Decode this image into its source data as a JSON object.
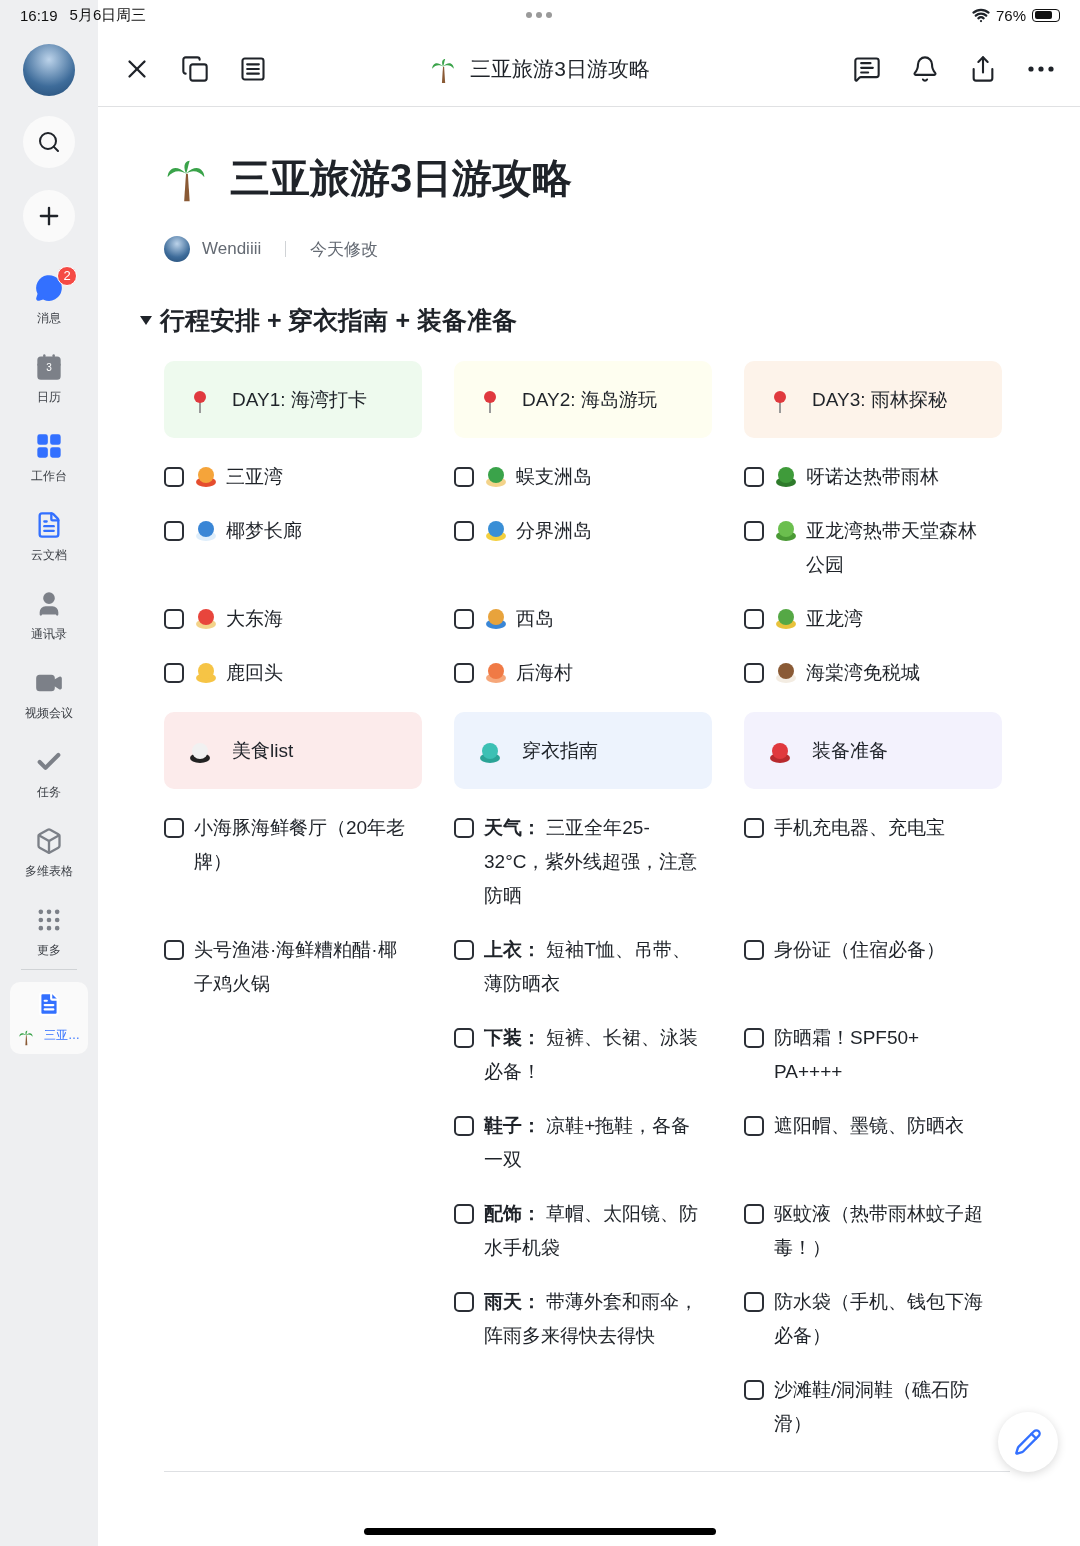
{
  "status_bar": {
    "time": "16:19",
    "date": "5月6日周三",
    "battery": "76%"
  },
  "sidebar": {
    "items": [
      {
        "label": "消息",
        "badge": "2",
        "selected": false
      },
      {
        "label": "日历",
        "calendar_day": "3",
        "selected": false
      },
      {
        "label": "工作台",
        "selected": false
      },
      {
        "label": "云文档",
        "selected": false
      },
      {
        "label": "通讯录",
        "selected": false
      },
      {
        "label": "视频会议",
        "selected": false
      },
      {
        "label": "任务",
        "selected": false
      },
      {
        "label": "多维表格",
        "selected": false
      },
      {
        "label": "更多",
        "selected": false
      }
    ],
    "open_doc": {
      "label": "三亚…",
      "selected": true
    }
  },
  "toolbar": {
    "title": "三亚旅游3日游攻略"
  },
  "document": {
    "title": "三亚旅游3日游攻略",
    "author": "Wendiiii",
    "modified": "今天修改",
    "section": {
      "title": "行程安排 + 穿衣指南 + 装备准备",
      "expanded": true,
      "groups": [
        {
          "columns": [
            {
              "header": "DAY1: 海湾打卡",
              "color": "#eefaee",
              "items": [
                {
                  "text": "三亚湾",
                  "checked": false
                },
                {
                  "text": "椰梦长廊",
                  "checked": false
                },
                {
                  "text": "大东海",
                  "checked": false
                },
                {
                  "text": "鹿回头",
                  "checked": false
                }
              ]
            },
            {
              "header": "DAY2: 海岛游玩",
              "color": "#fefef0",
              "items": [
                {
                  "text": "蜈支洲岛",
                  "checked": false
                },
                {
                  "text": "分界洲岛",
                  "checked": false
                },
                {
                  "text": "西岛",
                  "checked": false
                },
                {
                  "text": "后海村",
                  "checked": false
                }
              ]
            },
            {
              "header": "DAY3: 雨林探秘",
              "color": "#fdf3ea",
              "items": [
                {
                  "text": "呀诺达热带雨林",
                  "checked": false
                },
                {
                  "text": "亚龙湾热带天堂森林公园",
                  "checked": false
                },
                {
                  "text": "亚龙湾",
                  "checked": false
                },
                {
                  "text": "海棠湾免税城",
                  "checked": false
                }
              ]
            }
          ]
        },
        {
          "columns": [
            {
              "header": "美食list",
              "color": "#fcebeb",
              "items": [
                {
                  "text": "小海豚海鲜餐厅（20年老牌）",
                  "checked": false
                },
                {
                  "text": "头号渔港·海鲜糟粕醋·椰子鸡火锅",
                  "checked": false
                }
              ]
            },
            {
              "header": "穿衣指南",
              "color": "#edf3fd",
              "items": [
                {
                  "text": "**天气：** 三亚全年25-32°C，紫外线超强，注意防晒",
                  "checked": false
                },
                {
                  "text": "**上衣：** 短袖T恤、吊带、薄防晒衣",
                  "checked": false
                },
                {
                  "text": "**下装：** 短裤、长裙、泳装必备！",
                  "checked": false
                },
                {
                  "text": "**鞋子：** 凉鞋+拖鞋，各备一双",
                  "checked": false
                },
                {
                  "text": "**配饰：** 草帽、太阳镜、防水手机袋",
                  "checked": false
                },
                {
                  "text": "**雨天：** 带薄外套和雨伞，阵雨多来得快去得快",
                  "checked": false
                }
              ]
            },
            {
              "header": "装备准备",
              "color": "#f3f2fd",
              "items": [
                {
                  "text": "手机充电器、充电宝",
                  "checked": false
                },
                {
                  "text": "身份证（住宿必备）",
                  "checked": false
                },
                {
                  "text": "防晒霜！SPF50+ PA++++",
                  "checked": false
                },
                {
                  "text": "遮阳帽、墨镜、防晒衣",
                  "checked": false
                },
                {
                  "text": "驱蚊液（热带雨林蚊子超毒！）",
                  "checked": false
                },
                {
                  "text": "防水袋（手机、钱包下海必备）",
                  "checked": false
                },
                {
                  "text": "沙滩鞋/洞洞鞋（礁石防滑）",
                  "checked": false
                }
              ]
            }
          ]
        }
      ]
    }
  }
}
